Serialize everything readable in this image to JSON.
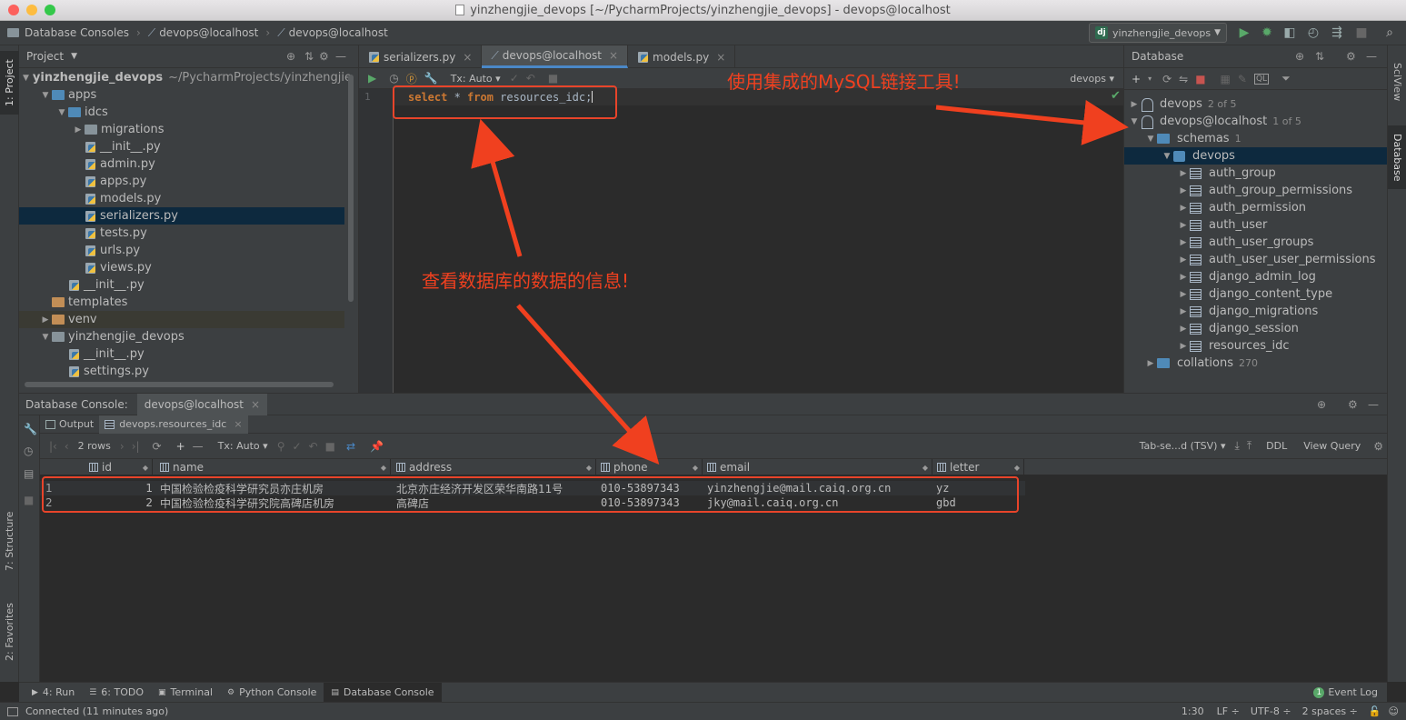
{
  "window": {
    "title": "yinzhengjie_devops [~/PycharmProjects/yinzhengjie_devops] - devops@localhost"
  },
  "breadcrumbs": [
    "Database Consoles",
    "devops@localhost",
    "devops@localhost"
  ],
  "run_config": {
    "label": "yinzhengjie_devops"
  },
  "project_panel": {
    "title": "Project",
    "tree": [
      {
        "label": "yinzhengjie_devops",
        "suffix": "~/PycharmProjects/yinzhengjie",
        "depth": 0,
        "type": "folder-root",
        "expanded": true
      },
      {
        "label": "apps",
        "depth": 1,
        "type": "folder-blue",
        "expanded": true
      },
      {
        "label": "idcs",
        "depth": 2,
        "type": "folder-blue",
        "expanded": true
      },
      {
        "label": "migrations",
        "depth": 3,
        "type": "folder",
        "expanded": false
      },
      {
        "label": "__init__.py",
        "depth": 3,
        "type": "py"
      },
      {
        "label": "admin.py",
        "depth": 3,
        "type": "py"
      },
      {
        "label": "apps.py",
        "depth": 3,
        "type": "py"
      },
      {
        "label": "models.py",
        "depth": 3,
        "type": "py"
      },
      {
        "label": "serializers.py",
        "depth": 3,
        "type": "py",
        "selected": true
      },
      {
        "label": "tests.py",
        "depth": 3,
        "type": "py"
      },
      {
        "label": "urls.py",
        "depth": 3,
        "type": "py"
      },
      {
        "label": "views.py",
        "depth": 3,
        "type": "py"
      },
      {
        "label": "__init__.py",
        "depth": 2,
        "type": "py"
      },
      {
        "label": "templates",
        "depth": 1,
        "type": "folder-tan"
      },
      {
        "label": "venv",
        "depth": 1,
        "type": "folder-tan",
        "expanded": false,
        "venv": true
      },
      {
        "label": "yinzhengjie_devops",
        "depth": 1,
        "type": "folder",
        "expanded": true
      },
      {
        "label": "__init__.py",
        "depth": 2,
        "type": "py"
      },
      {
        "label": "settings.py",
        "depth": 2,
        "type": "py"
      }
    ]
  },
  "left_tool_tabs": [
    "1: Project",
    "7: Structure",
    "2: Favorites"
  ],
  "right_tool_tabs": [
    "SciView",
    "Database"
  ],
  "editor": {
    "tabs": [
      {
        "label": "serializers.py",
        "active": false
      },
      {
        "label": "devops@localhost",
        "active": true
      },
      {
        "label": "models.py",
        "active": false
      }
    ],
    "tx_mode": "Tx: Auto",
    "schema_selector": "devops",
    "line_number": "1",
    "code": {
      "kw1": "select",
      "star": " * ",
      "kw2": "from",
      "rest": " resources_idc;"
    }
  },
  "database_panel": {
    "title": "Database",
    "tree": [
      {
        "label": "devops",
        "count": "2 of 5",
        "depth": 0,
        "type": "conn",
        "expanded": false
      },
      {
        "label": "devops@localhost",
        "count": "1 of 5",
        "depth": 0,
        "type": "conn",
        "expanded": true
      },
      {
        "label": "schemas",
        "count": "1",
        "depth": 1,
        "type": "folder-blue",
        "expanded": true
      },
      {
        "label": "devops",
        "depth": 2,
        "type": "schema",
        "expanded": true,
        "selected": true
      },
      {
        "label": "auth_group",
        "depth": 3,
        "type": "table"
      },
      {
        "label": "auth_group_permissions",
        "depth": 3,
        "type": "table"
      },
      {
        "label": "auth_permission",
        "depth": 3,
        "type": "table"
      },
      {
        "label": "auth_user",
        "depth": 3,
        "type": "table"
      },
      {
        "label": "auth_user_groups",
        "depth": 3,
        "type": "table"
      },
      {
        "label": "auth_user_user_permissions",
        "depth": 3,
        "type": "table"
      },
      {
        "label": "django_admin_log",
        "depth": 3,
        "type": "table"
      },
      {
        "label": "django_content_type",
        "depth": 3,
        "type": "table"
      },
      {
        "label": "django_migrations",
        "depth": 3,
        "type": "table"
      },
      {
        "label": "django_session",
        "depth": 3,
        "type": "table"
      },
      {
        "label": "resources_idc",
        "depth": 3,
        "type": "table"
      },
      {
        "label": "collations",
        "count": "270",
        "depth": 1,
        "type": "folder-blue",
        "expanded": false
      }
    ]
  },
  "bottom_panel": {
    "title": "Database Console:",
    "console_tab": "devops@localhost",
    "subtabs": [
      "Output",
      "devops.resources_idc"
    ],
    "rows_label": "2 rows",
    "tx_mode": "Tx: Auto",
    "export_format": "Tab-se...d (TSV)",
    "ddl_label": "DDL",
    "view_query_label": "View Query",
    "columns": [
      "id",
      "name",
      "address",
      "phone",
      "email",
      "letter"
    ],
    "rows": [
      {
        "num": "1",
        "id": "1",
        "name": "中国检验检疫科学研究员亦庄机房",
        "address": "北京亦庄经济开发区荣华南路11号",
        "phone": "010-53897343",
        "email": "yinzhengjie@mail.caiq.org.cn",
        "letter": "yz"
      },
      {
        "num": "2",
        "id": "2",
        "name": "中国检验检疫科学研究院高碑店机房",
        "address": "高碑店",
        "phone": "010-53897343",
        "email": "jky@mail.caiq.org.cn",
        "letter": "gbd"
      }
    ]
  },
  "tool_windows": [
    {
      "label": "4: Run",
      "icon": "run-icon"
    },
    {
      "label": "6: TODO",
      "icon": "todo-icon"
    },
    {
      "label": "Terminal",
      "icon": "terminal-icon"
    },
    {
      "label": "Python Console",
      "icon": "python-icon"
    },
    {
      "label": "Database Console",
      "icon": "database-icon",
      "active": true
    }
  ],
  "event_log": {
    "count": "1",
    "label": "Event Log"
  },
  "status": {
    "message": "Connected (11 minutes ago)",
    "position": "1:30",
    "line_sep": "LF",
    "encoding": "UTF-8",
    "indent": "2 spaces"
  },
  "annotations": {
    "mysql_tool": "使用集成的MySQL链接工具!",
    "view_data": "查看数据库的数据的信息!"
  },
  "colors": {
    "accent": "#4a88c7",
    "annotation": "#f0401f",
    "keyword": "#cc7832"
  }
}
